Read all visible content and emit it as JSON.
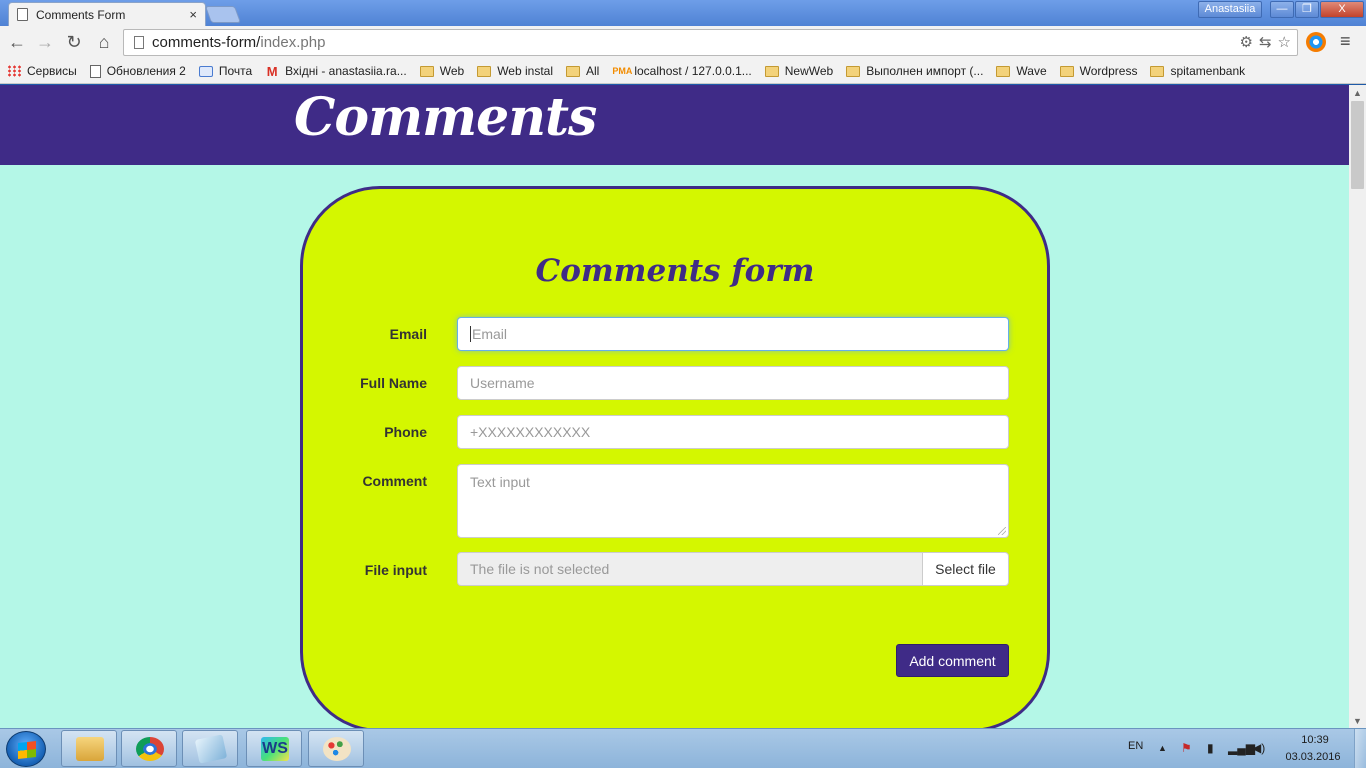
{
  "browser": {
    "tab_title": "Comments Form",
    "tab_close": "×",
    "user_name": "Anastasiia",
    "window_minimize": "—",
    "window_maximize": "❐",
    "window_close": "X",
    "url_host": "comments-form/",
    "url_path": "index.php",
    "bookmarks": [
      {
        "label": "Сервисы",
        "icon": "apps-icon"
      },
      {
        "label": "Обновления 2",
        "icon": "page-icon"
      },
      {
        "label": "Почта",
        "icon": "mail-icon"
      },
      {
        "label": "Вхідні - anastasiia.ra...",
        "icon": "gmail-icon"
      },
      {
        "label": "Web",
        "icon": "folder-icon"
      },
      {
        "label": "Web instal",
        "icon": "folder-icon"
      },
      {
        "label": "All",
        "icon": "folder-icon"
      },
      {
        "label": "localhost / 127.0.0.1...",
        "icon": "phpmyadmin-icon"
      },
      {
        "label": "NewWeb",
        "icon": "folder-icon"
      },
      {
        "label": "Выполнен импорт (...",
        "icon": "folder-icon"
      },
      {
        "label": "Wave",
        "icon": "folder-icon"
      },
      {
        "label": "Wordpress",
        "icon": "folder-icon"
      },
      {
        "label": "spitamenbank",
        "icon": "folder-icon"
      }
    ]
  },
  "site": {
    "logo": "Comments"
  },
  "form": {
    "title": "Comments form",
    "email_label": "Email",
    "email_placeholder": "Email",
    "fullname_label": "Full Name",
    "fullname_placeholder": "Username",
    "phone_label": "Phone",
    "phone_placeholder": "+XXXXXXXXXXXX",
    "comment_label": "Comment",
    "comment_placeholder": "Text input",
    "file_label": "File input",
    "file_status": "The file is not selected",
    "file_button": "Select file",
    "submit": "Add comment"
  },
  "taskbar": {
    "language": "EN",
    "time": "10:39",
    "date": "03.03.2016"
  }
}
